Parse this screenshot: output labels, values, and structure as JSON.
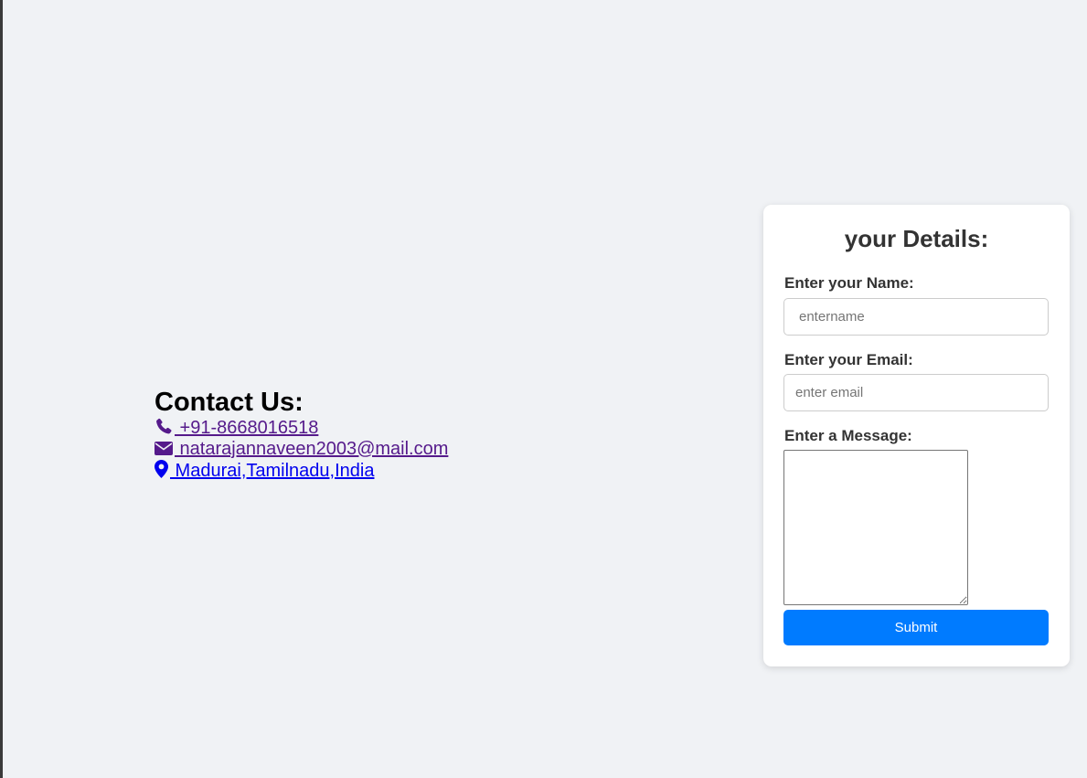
{
  "contact": {
    "heading": "Contact Us:",
    "phone": " +91-8668016518",
    "email": " natarajannaveen2003@mail.com",
    "location": " Madurai,Tamilnadu,India",
    "icons": [
      "phone-icon",
      "envelope-icon",
      "map-marker-icon"
    ],
    "colors": {
      "visited": "#551a8b",
      "unvisited": "#0000ee"
    }
  },
  "form": {
    "title": "your Details:",
    "name_label": "Enter your Name:",
    "name_placeholder": "entername",
    "email_label": "Enter your Email:",
    "email_placeholder": "enter email",
    "message_label": "Enter a Message:",
    "submit_label": "Submit",
    "colors": {
      "submit": "#007bff",
      "background": "#f0f2f5"
    }
  }
}
